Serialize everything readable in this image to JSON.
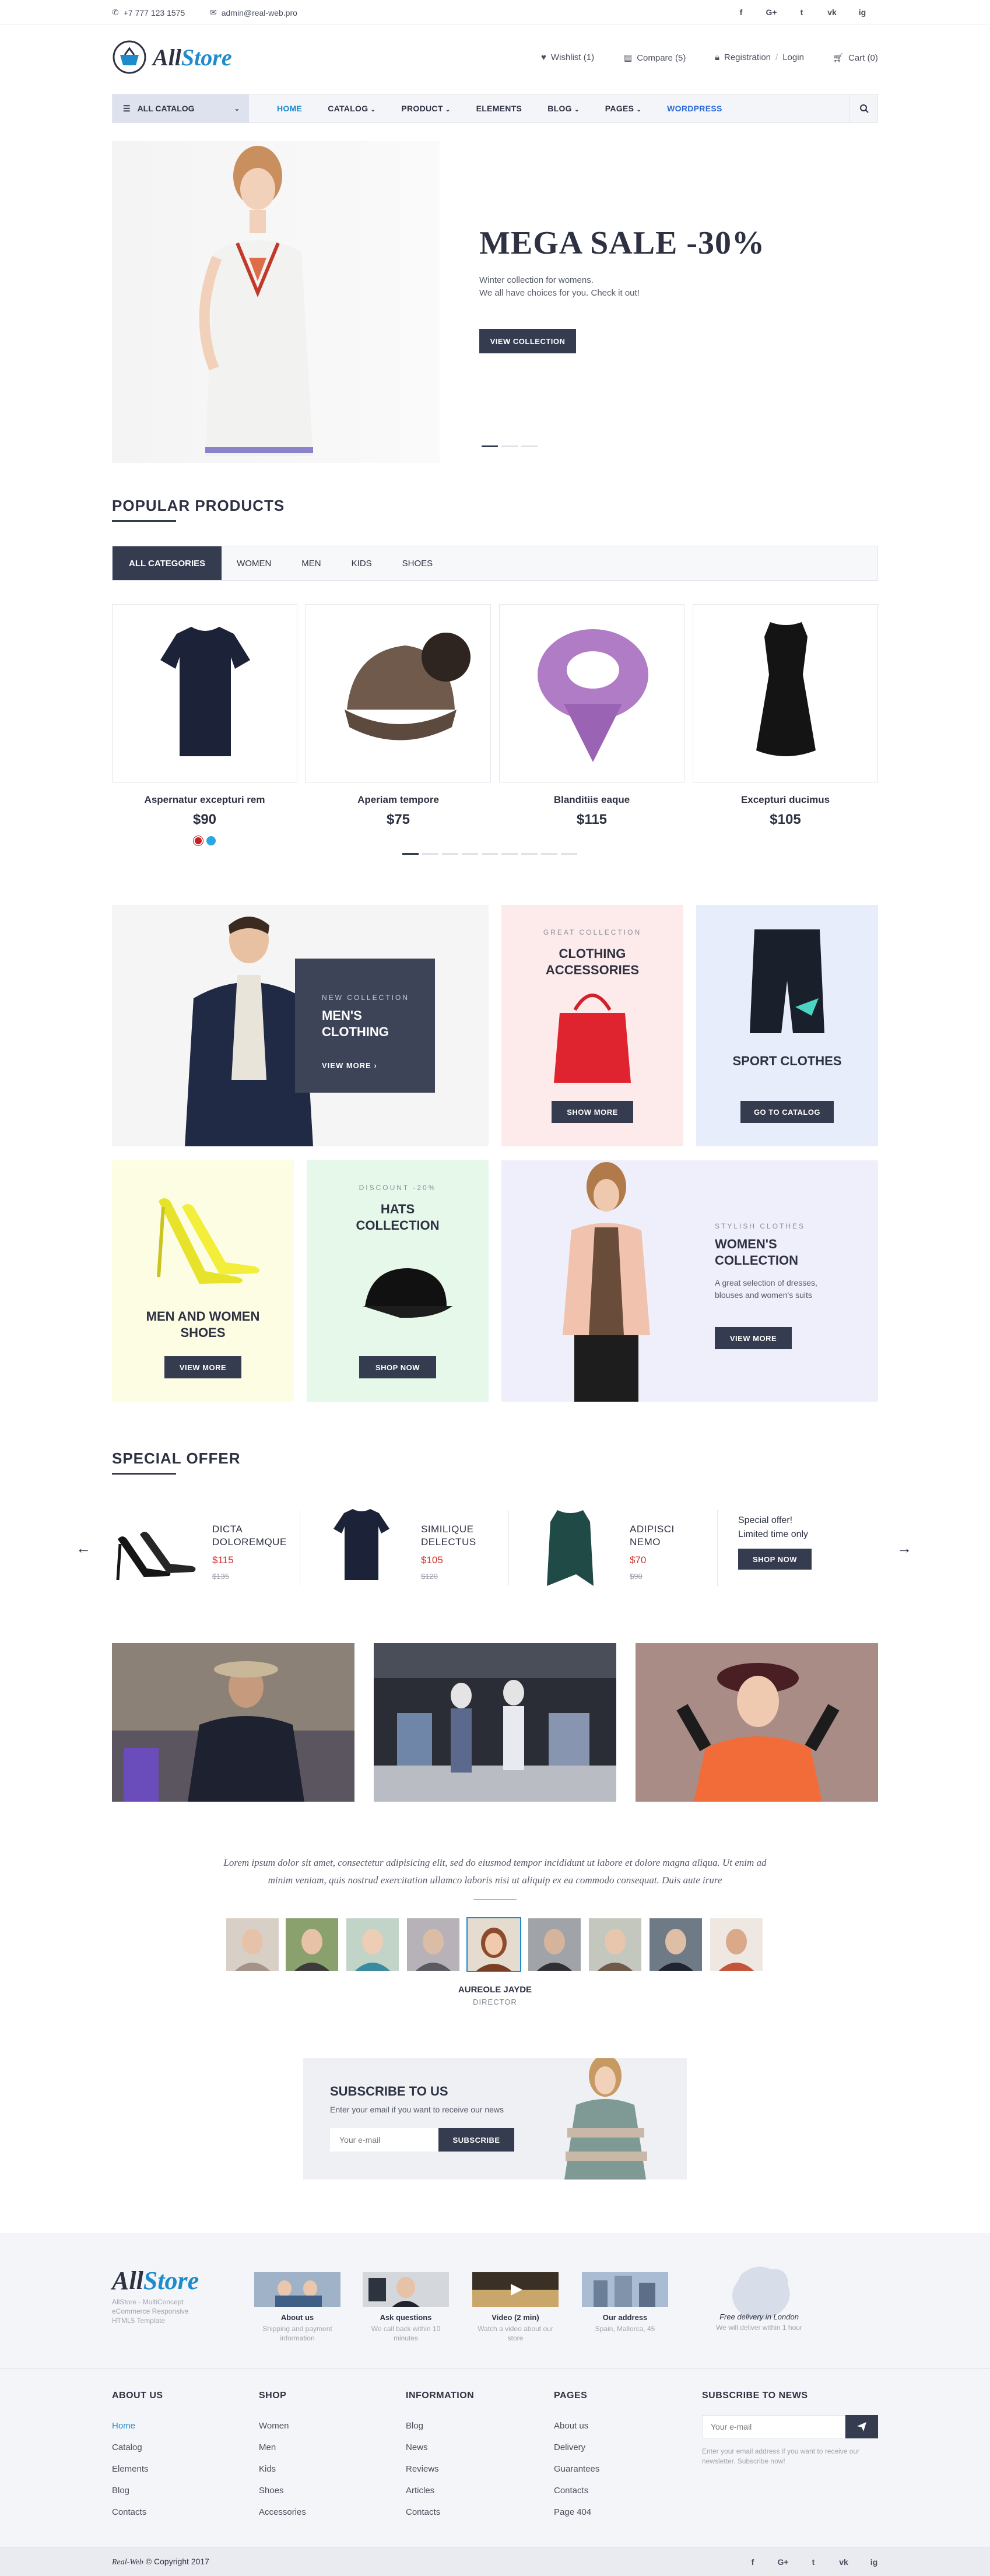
{
  "topbar": {
    "phone": "+7 777 123 1575",
    "email": "admin@real-web.pro",
    "social": [
      "f",
      "G+",
      "t",
      "vk",
      "ig"
    ]
  },
  "header": {
    "logo_text_a": "All",
    "logo_text_b": "Store",
    "wishlist": "Wishlist (1)",
    "compare": "Compare (5)",
    "registration": "Registration",
    "login": "Login",
    "cart": "Cart (0)"
  },
  "nav": {
    "all_catalog": "ALL CATALOG",
    "items": [
      "HOME",
      "CATALOG",
      "PRODUCT",
      "ELEMENTS",
      "BLOG",
      "PAGES",
      "WORDPRESS"
    ]
  },
  "hero": {
    "title": "MEGA SALE -30%",
    "line1": "Winter collection for womens.",
    "line2": "We all have choices for you. Check it out!",
    "button": "VIEW COLLECTION"
  },
  "popular": {
    "title": "POPULAR PRODUCTS",
    "tabs": [
      "ALL CATEGORIES",
      "WOMEN",
      "MEN",
      "KIDS",
      "SHOES"
    ],
    "products": [
      {
        "name": "Aspernatur excepturi rem",
        "price": "$90"
      },
      {
        "name": "Aperiam tempore",
        "price": "$75"
      },
      {
        "name": "Blanditiis eaque",
        "price": "$115"
      },
      {
        "name": "Excepturi ducimus",
        "price": "$105"
      }
    ]
  },
  "banners": {
    "mens_small": "NEW COLLECTION",
    "mens_title": "MEN'S CLOTHING",
    "mens_button": "VIEW MORE",
    "acc_small": "GREAT COLLECTION",
    "acc_title": "CLOTHING ACCESSORIES",
    "acc_button": "SHOW MORE",
    "sport_title": "SPORT CLOTHES",
    "sport_button": "GO TO CATALOG",
    "shoes_title": "MEN AND WOMEN SHOES",
    "shoes_button": "VIEW MORE",
    "hats_small": "DISCOUNT -20%",
    "hats_title": "HATS COLLECTION",
    "hats_button": "SHOP NOW",
    "women_small": "STYLISH CLOTHES",
    "women_title": "WOMEN'S COLLECTION",
    "women_desc": "A great selection of dresses, blouses and women's suits",
    "women_button": "VIEW MORE"
  },
  "special": {
    "title": "SPECIAL OFFER",
    "items": [
      {
        "name_a": "DICTA",
        "name_b": "DOLOREMQUE",
        "price": "$115",
        "old": "$135"
      },
      {
        "name_a": "SIMILIQUE",
        "name_b": "DELECTUS",
        "price": "$105",
        "old": "$120"
      },
      {
        "name_a": "ADIPISCI",
        "name_b": "NEMO",
        "price": "$70",
        "old": "$90"
      }
    ],
    "promo_a": "Special offer!",
    "promo_b": "Limited time only",
    "promo_button": "SHOP NOW"
  },
  "testimonial": {
    "quote": "Lorem ipsum dolor sit amet, consectetur adipisicing elit, sed do eiusmod tempor incididunt ut labore et dolore magna aliqua. Ut enim ad minim veniam, quis nostrud exercitation ullamco laboris nisi ut aliquip ex ea commodo consequat. Duis aute irure",
    "name": "AUREOLE JAYDE",
    "role": "DIRECTOR"
  },
  "subscribe": {
    "title": "SUBSCRIBE TO US",
    "text": "Enter your email if you want to receive our news",
    "placeholder": "Your e-mail",
    "button": "SUBSCRIBE"
  },
  "footer": {
    "logo_a": "All",
    "logo_b": "Store",
    "tagline": "AllStore - MultiConcept eCommerce Responsive HTML5 Template",
    "boxes": [
      {
        "title": "About us",
        "sub": "Shipping and payment information"
      },
      {
        "title": "Ask questions",
        "sub": "We call back within 10 minutes"
      },
      {
        "title": "Video (2 min)",
        "sub": "Watch a video about our store"
      },
      {
        "title": "Our address",
        "sub": "Spain, Mallorca, 45"
      }
    ],
    "delivery_title": "Free delivery in London",
    "delivery_sub": "We will deliver within 1 hour",
    "cols": [
      {
        "title": "ABOUT US",
        "items": [
          "Home",
          "Catalog",
          "Elements",
          "Blog",
          "Contacts"
        ]
      },
      {
        "title": "SHOP",
        "items": [
          "Women",
          "Men",
          "Kids",
          "Shoes",
          "Accessories"
        ]
      },
      {
        "title": "INFORMATION",
        "items": [
          "Blog",
          "News",
          "Reviews",
          "Articles",
          "Contacts"
        ]
      },
      {
        "title": "PAGES",
        "items": [
          "About us",
          "Delivery",
          "Guarantees",
          "Contacts",
          "Page 404"
        ]
      }
    ],
    "news_title": "SUBSCRIBE TO NEWS",
    "news_placeholder": "Your e-mail",
    "news_note": "Enter your email address if you want to receive our newsletter. Subscribe now!",
    "copyright_a": "Real-Web",
    "copyright_b": "© Copyright 2017"
  }
}
